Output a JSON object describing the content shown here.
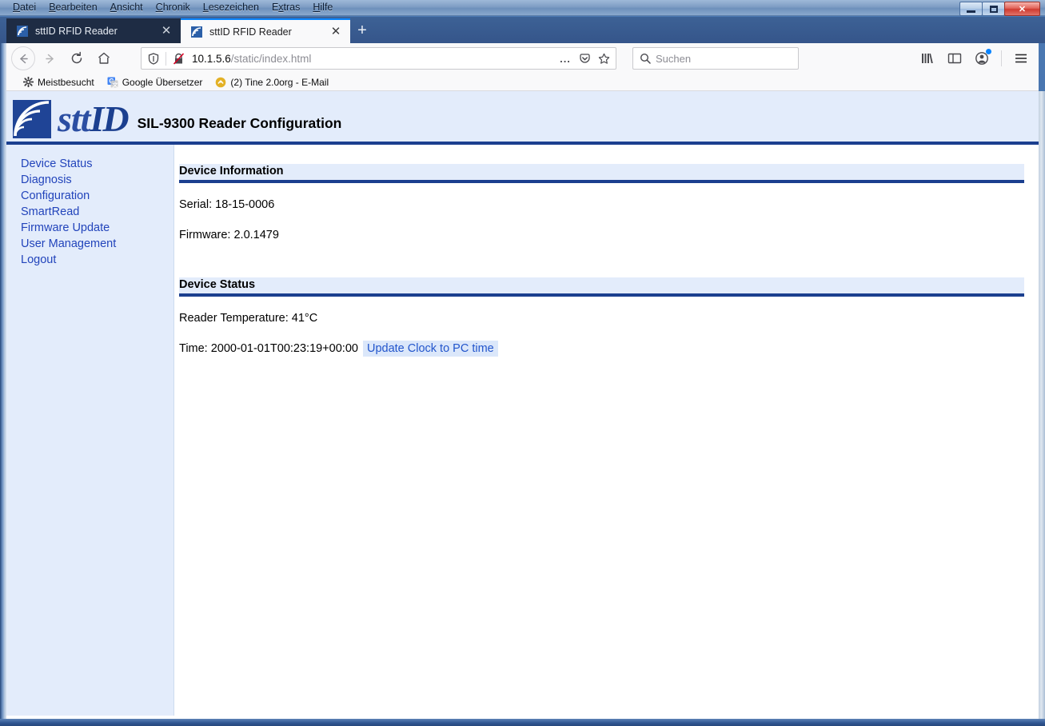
{
  "browser": {
    "menubar": [
      {
        "label": "Datei",
        "accel": "D"
      },
      {
        "label": "Bearbeiten",
        "accel": "B"
      },
      {
        "label": "Ansicht",
        "accel": "A"
      },
      {
        "label": "Chronik",
        "accel": "C"
      },
      {
        "label": "Lesezeichen",
        "accel": "L"
      },
      {
        "label": "Extras",
        "accel": "x"
      },
      {
        "label": "Hilfe",
        "accel": "H"
      }
    ],
    "window_controls": {
      "minimize": "minimize-icon",
      "maximize": "maximize-icon",
      "close": "✕"
    },
    "tabs": [
      {
        "title": "sttID RFID Reader",
        "active": false,
        "close": "✕",
        "favicon": "sttid-wave-icon"
      },
      {
        "title": "sttID RFID Reader",
        "active": true,
        "close": "✕",
        "favicon": "sttid-wave-icon"
      }
    ],
    "new_tab_label": "+",
    "nav": {
      "back": "back-arrow-icon",
      "forward": "forward-arrow-icon",
      "reload": "reload-icon",
      "home": "home-icon"
    },
    "url": {
      "host": "10.1.5.6",
      "path": "/static/index.html",
      "shield_icon": "shield-icon",
      "insecure_icon": "insecure-connection-icon",
      "page_actions": "...",
      "pocket_icon": "pocket-icon",
      "bookmark_star_icon": "star-icon"
    },
    "search": {
      "placeholder": "Suchen",
      "icon": "search-icon"
    },
    "toolbar_right": [
      {
        "name": "library-icon"
      },
      {
        "name": "sidebar-icon"
      },
      {
        "name": "account-icon"
      },
      {
        "name": "hamburger-menu-icon"
      }
    ],
    "bookmarks": [
      {
        "label": "Meistbesucht",
        "icon": "gear-icon"
      },
      {
        "label": "Google Übersetzer",
        "icon": "google-translate-icon"
      },
      {
        "label": "(2) Tine 2.0org - E-Mail",
        "icon": "tine-icon"
      }
    ]
  },
  "page": {
    "brand": {
      "word_stt": "stt",
      "word_id": "ID",
      "logo_icon": "rfid-wave-logo"
    },
    "title": "SIL-9300 Reader Configuration",
    "sidebar": {
      "items": [
        {
          "label": "Device Status"
        },
        {
          "label": "Diagnosis"
        },
        {
          "label": "Configuration"
        },
        {
          "label": "SmartRead"
        },
        {
          "label": "Firmware Update"
        },
        {
          "label": "User Management"
        },
        {
          "label": "Logout"
        }
      ]
    },
    "sections": [
      {
        "heading": "Device Information",
        "rows": [
          {
            "text": "Serial: 18-15-0006"
          },
          {
            "text": "Firmware: 2.0.1479"
          }
        ]
      },
      {
        "heading": "Device Status",
        "rows": [
          {
            "text": "Reader Temperature: 41°C"
          },
          {
            "text": "Time: 2000-01-01T00:23:19+00:00",
            "link": "Update Clock to PC time"
          }
        ]
      }
    ]
  },
  "colors": {
    "accent_blue": "#1b3f8f",
    "panel_blue": "#e3ecfb",
    "link_blue": "#2244bb",
    "brand_blue": "#2b4ea2"
  }
}
